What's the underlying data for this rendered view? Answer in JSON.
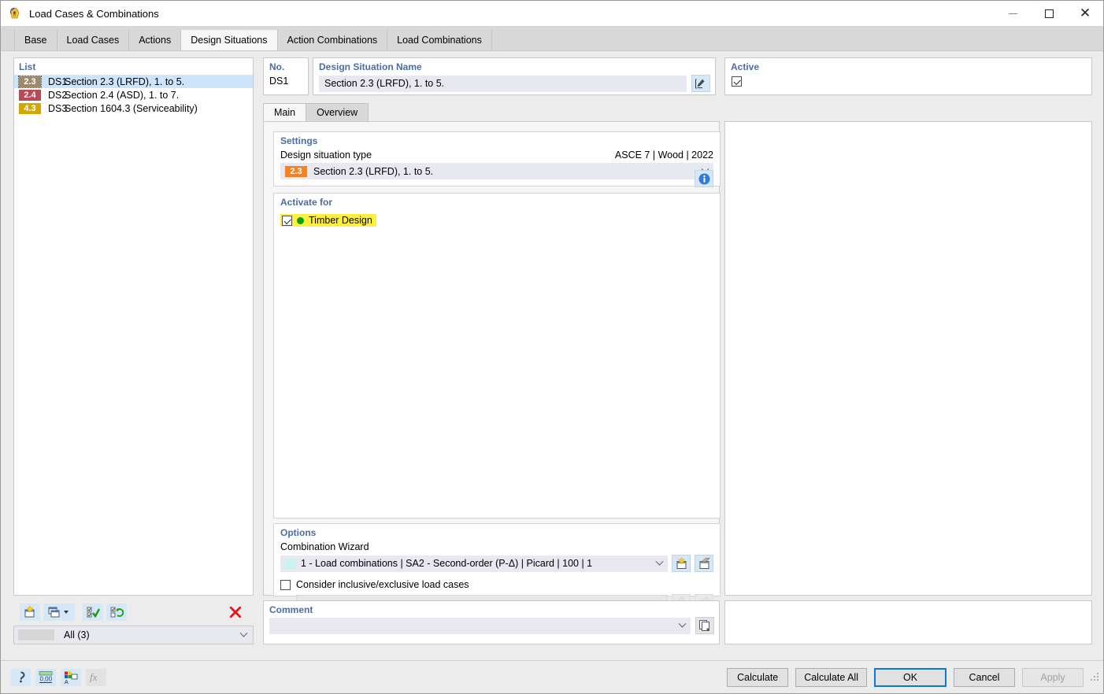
{
  "window": {
    "title": "Load Cases & Combinations",
    "icon": "load-case-icon",
    "minimize": "–",
    "maximize": "□",
    "close": "✕"
  },
  "tabs": [
    {
      "label": "Base",
      "active": false
    },
    {
      "label": "Load Cases",
      "active": false
    },
    {
      "label": "Actions",
      "active": false
    },
    {
      "label": "Design Situations",
      "active": true
    },
    {
      "label": "Action Combinations",
      "active": false
    },
    {
      "label": "Load Combinations",
      "active": false
    }
  ],
  "list": {
    "header": "List",
    "rows": [
      {
        "badge": "2.3",
        "badge_color": "#9e8a6b",
        "no": "DS1",
        "name": "Section 2.3 (LRFD), 1. to 5.",
        "selected": true
      },
      {
        "badge": "2.4",
        "badge_color": "#b64a55",
        "no": "DS2",
        "name": "Section 2.4 (ASD), 1. to 7.",
        "selected": false
      },
      {
        "badge": "4.3",
        "badge_color": "#d4a700",
        "no": "DS3",
        "name": "Section 1604.3 (Serviceability)",
        "selected": false
      }
    ],
    "toolbar": [
      {
        "icon": "new-design-situation-icon",
        "enabled": true
      },
      {
        "icon": "copy-design-situation-icon",
        "enabled": true
      },
      {
        "icon": "dropdown-arrow-icon",
        "enabled": true
      },
      {
        "icon": "select-all-icon",
        "enabled": true
      },
      {
        "icon": "invert-selection-icon",
        "enabled": true
      },
      {
        "icon": "delete-icon",
        "enabled": true
      }
    ],
    "filter": {
      "label": "All (3)",
      "swatch_color": "#d6d6d6"
    }
  },
  "no_field": {
    "header": "No.",
    "value": "DS1"
  },
  "name_field": {
    "header": "Design Situation Name",
    "value": "Section 2.3 (LRFD), 1. to 5.",
    "edit_icon": "edit-name-icon"
  },
  "active_field": {
    "header": "Active",
    "checked": true
  },
  "inner_tabs": [
    {
      "label": "Main",
      "active": true
    },
    {
      "label": "Overview",
      "active": false
    }
  ],
  "settings": {
    "header": "Settings",
    "type_label": "Design situation type",
    "standard": "ASCE 7 | Wood | 2022",
    "type_badge": "2.3",
    "type_badge_color": "#f58220",
    "type_value": "Section 2.3 (LRFD), 1. to 5.",
    "info_icon": "info-icon"
  },
  "activate_for": {
    "header": "Activate for",
    "items": [
      {
        "label": "Timber Design",
        "checked": true,
        "dot_color": "#00a400",
        "highlight": "#ffef3e"
      }
    ]
  },
  "options": {
    "header": "Options",
    "wizard_label": "Combination Wizard",
    "wizard_value": "1 - Load combinations | SA2 - Second-order (P-Δ) | Picard | 100 | 1",
    "wizard_swatch_color": "#ccf2f2",
    "wizard_new_icon": "new-wizard-icon",
    "wizard_edit_icon": "edit-wizard-icon",
    "consider_label": "Consider inclusive/exclusive load cases",
    "consider_checked": false,
    "consider_value": "",
    "consider_new_icon": "new-inclusive-icon",
    "consider_edit_icon": "edit-inclusive-icon"
  },
  "comment": {
    "header": "Comment",
    "value": "",
    "copy_icon": "comment-library-icon"
  },
  "bottom_bar": {
    "icons": [
      {
        "name": "help-icon",
        "enabled": true
      },
      {
        "name": "decimal-places-icon",
        "enabled": true
      },
      {
        "name": "units-icon",
        "enabled": true
      },
      {
        "name": "formula-icon",
        "enabled": false
      }
    ],
    "buttons": [
      {
        "label": "Calculate",
        "style": "normal"
      },
      {
        "label": "Calculate All",
        "style": "normal"
      },
      {
        "label": "OK",
        "style": "default"
      },
      {
        "label": "Cancel",
        "style": "normal"
      },
      {
        "label": "Apply",
        "style": "disabled"
      }
    ]
  }
}
